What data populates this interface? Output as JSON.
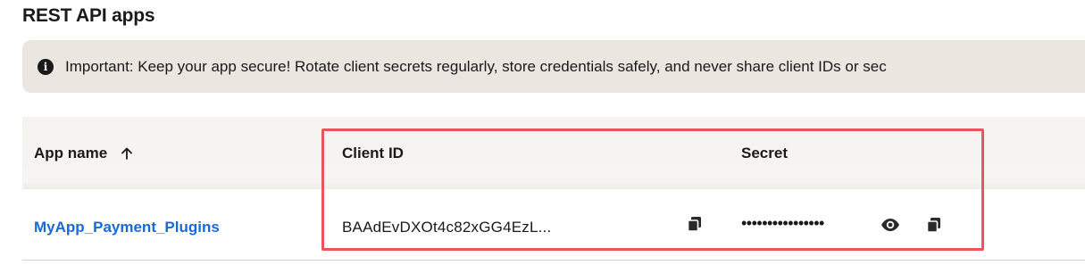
{
  "page": {
    "title": "REST API apps"
  },
  "notice": {
    "icon": "info-icon",
    "text": "Important: Keep your app secure! Rotate client secrets regularly, store credentials safely, and never share client IDs or sec"
  },
  "table": {
    "headers": {
      "app_name": "App name",
      "client_id": "Client ID",
      "secret": "Secret"
    },
    "sort_icon": "arrow-up-icon",
    "rows": [
      {
        "app_name": "MyApp_Payment_Plugins",
        "client_id": "BAAdEvDXOt4c82xGG4EzL...",
        "secret": "••••••••••••••••"
      }
    ]
  },
  "colors": {
    "link": "#1a6ad6",
    "notice_bg": "#ebe6df",
    "highlight_border": "#e8555a",
    "header_bg": "#f5f3f0"
  }
}
